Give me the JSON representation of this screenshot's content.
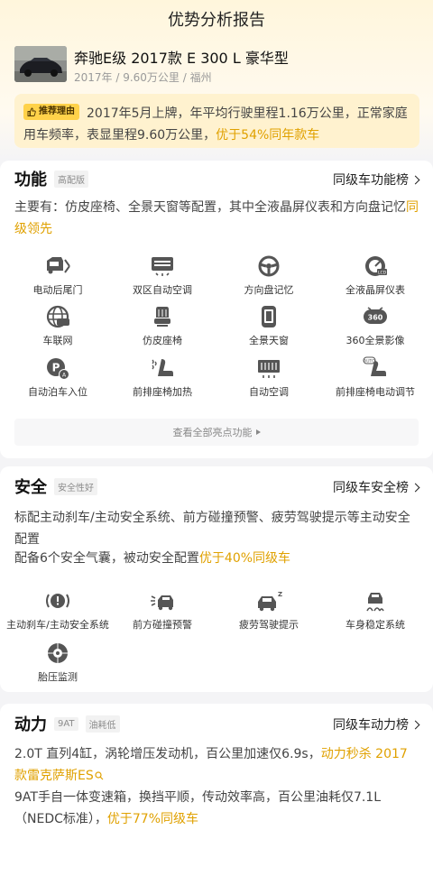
{
  "header": {
    "title": "优势分析报告"
  },
  "car": {
    "name": "奔驰E级 2017款 E 300 L 豪华型",
    "meta": "2017年 / 9.60万公里 / 福州",
    "reason_tag": "推荐理由",
    "reason_text": "2017年5月上牌，年平均行驶里程1.16万公里，正常家庭用车频率，表显里程9.60万公里，",
    "reason_highlight": "优于54%同年款车"
  },
  "function": {
    "title": "功能",
    "tag": "高配版",
    "rank_label": "同级车功能榜",
    "desc": "主要有：仿皮座椅、全景天窗等配置，其中全液晶屏仪表和方向盘记忆",
    "desc_highlight": "同级领先",
    "features": [
      {
        "label": "电动后尾门",
        "icon": "tailgate-icon"
      },
      {
        "label": "双区自动空调",
        "icon": "dual-ac-icon"
      },
      {
        "label": "方向盘记忆",
        "icon": "steering-wheel-icon"
      },
      {
        "label": "全液晶屏仪表",
        "icon": "lcd-gauge-icon"
      },
      {
        "label": "车联网",
        "icon": "connected-car-icon"
      },
      {
        "label": "仿皮座椅",
        "icon": "leather-seat-icon"
      },
      {
        "label": "全景天窗",
        "icon": "panoramic-sunroof-icon"
      },
      {
        "label": "360全景影像",
        "icon": "camera-360-icon"
      },
      {
        "label": "自动泊车入位",
        "icon": "auto-parking-icon"
      },
      {
        "label": "前排座椅加热",
        "icon": "seat-heating-icon"
      },
      {
        "label": "自动空调",
        "icon": "auto-ac-icon"
      },
      {
        "label": "前排座椅电动调节",
        "icon": "power-seat-icon"
      }
    ],
    "view_all": "查看全部亮点功能"
  },
  "safety": {
    "title": "安全",
    "tag": "安全性好",
    "rank_label": "同级车安全榜",
    "desc1": "标配主动刹车/主动安全系统、前方碰撞预警、疲劳驾驶提示等主动安全配置",
    "desc2": "配备6个安全气囊，被动安全配置",
    "desc2_highlight": "优于40%同级车",
    "features": [
      {
        "label": "主动刹车/主动安全系统",
        "icon": "active-brake-icon"
      },
      {
        "label": "前方碰撞预警",
        "icon": "collision-warning-icon"
      },
      {
        "label": "疲劳驾驶提示",
        "icon": "fatigue-alert-icon"
      },
      {
        "label": "车身稳定系统",
        "icon": "stability-control-icon"
      },
      {
        "label": "胎压监测",
        "icon": "tire-pressure-icon"
      }
    ]
  },
  "power": {
    "title": "动力",
    "tag1": "9AT",
    "tag2": "油耗低",
    "rank_label": "同级车动力榜",
    "desc1": "2.0T 直列4缸，涡轮增压发动机，百公里加速仅6.9s，",
    "desc1_highlight": "动力秒杀 2017款雷克萨斯ES",
    "desc2": "9AT手自一体变速箱，换挡平顺，传动效率高，百公里油耗仅7.1L（NEDC标准），",
    "desc2_highlight": "优于77%同级车"
  },
  "colors": {
    "accent": "#e0a100",
    "tag_bg": "#ffd24a",
    "icon": "#555555"
  }
}
